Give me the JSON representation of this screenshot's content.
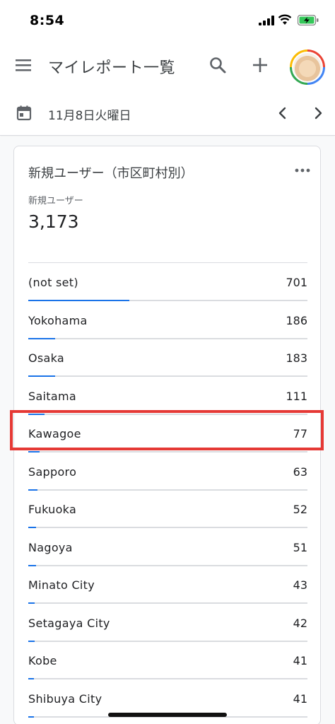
{
  "status_bar": {
    "time": "8:54"
  },
  "app_bar": {
    "title": "マイレポート一覧"
  },
  "date_bar": {
    "date": "11月8日火曜日"
  },
  "card": {
    "title": "新規ユーザー（市区町村別）",
    "metric_label": "新規ユーザー",
    "metric_value": "3,173",
    "rows": [
      {
        "label": "(not set)",
        "value": "701",
        "fraction": 0.363
      },
      {
        "label": "Yokohama",
        "value": "186",
        "fraction": 0.097
      },
      {
        "label": "Osaka",
        "value": "183",
        "fraction": 0.095
      },
      {
        "label": "Saitama",
        "value": "111",
        "fraction": 0.058
      },
      {
        "label": "Kawagoe",
        "value": "77",
        "fraction": 0.04
      },
      {
        "label": "Sapporo",
        "value": "63",
        "fraction": 0.033
      },
      {
        "label": "Fukuoka",
        "value": "52",
        "fraction": 0.027
      },
      {
        "label": "Nagoya",
        "value": "51",
        "fraction": 0.027
      },
      {
        "label": "Minato City",
        "value": "43",
        "fraction": 0.022
      },
      {
        "label": "Setagaya City",
        "value": "42",
        "fraction": 0.022
      },
      {
        "label": "Kobe",
        "value": "41",
        "fraction": 0.021
      },
      {
        "label": "Shibuya City",
        "value": "41",
        "fraction": 0.021
      }
    ]
  },
  "highlight": {
    "row": "Kawagoe",
    "color": "#e53935"
  },
  "colors": {
    "accent": "#1a73e8",
    "track": "#dadce0",
    "text": "#202124"
  },
  "icons": [
    "menu-icon",
    "search-icon",
    "add-icon",
    "calendar-icon",
    "chevron-left-icon",
    "chevron-right-icon",
    "more-vert-icon",
    "signal-icon",
    "wifi-icon",
    "battery-icon"
  ]
}
